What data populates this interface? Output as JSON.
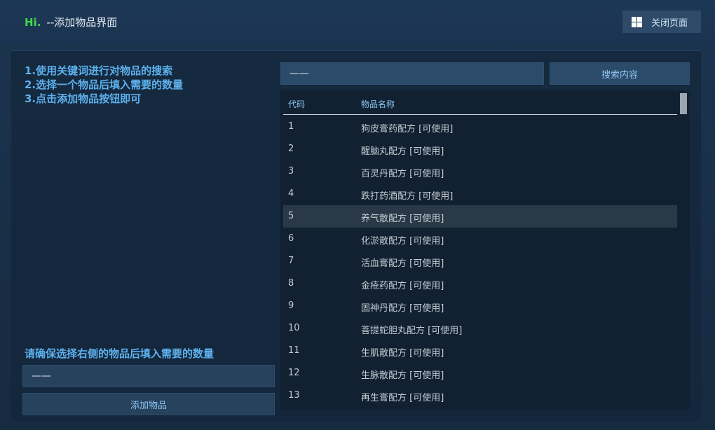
{
  "header": {
    "hi": "Hi.",
    "title": "--添加物品界面",
    "close_label": "关闭页面"
  },
  "left": {
    "instructions": [
      "1.使用关键词进行对物品的搜索",
      "2.选择一个物品后填入需要的数量",
      "3.点击添加物品按钮即可"
    ],
    "notice": "请确保选择右侧的物品后填入需要的数量",
    "quantity_value": "——",
    "add_label": "添加物品"
  },
  "search": {
    "value": "——",
    "button_label": "搜索内容"
  },
  "list": {
    "columns": [
      "代码",
      "物品名称"
    ],
    "selected_code": "5",
    "rows": [
      {
        "code": "1",
        "name": "狗皮膏药配方 [可使用]"
      },
      {
        "code": "2",
        "name": "醒脑丸配方 [可使用]"
      },
      {
        "code": "3",
        "name": "百灵丹配方 [可使用]"
      },
      {
        "code": "4",
        "name": "跌打药酒配方 [可使用]"
      },
      {
        "code": "5",
        "name": "养气散配方 [可使用]"
      },
      {
        "code": "6",
        "name": "化淤散配方 [可使用]"
      },
      {
        "code": "7",
        "name": "活血膏配方 [可使用]"
      },
      {
        "code": "8",
        "name": "金疮药配方 [可使用]"
      },
      {
        "code": "9",
        "name": "固神丹配方 [可使用]"
      },
      {
        "code": "10",
        "name": "菩提蛇胆丸配方 [可使用]"
      },
      {
        "code": "11",
        "name": "生肌散配方 [可使用]"
      },
      {
        "code": "12",
        "name": "生脉散配方 [可使用]"
      },
      {
        "code": "13",
        "name": "再生膏配方 [可使用]"
      }
    ]
  },
  "colors": {
    "accent": "#5db0ec",
    "brand": "#3fdb4a",
    "button_text": "#8ec7f3"
  }
}
